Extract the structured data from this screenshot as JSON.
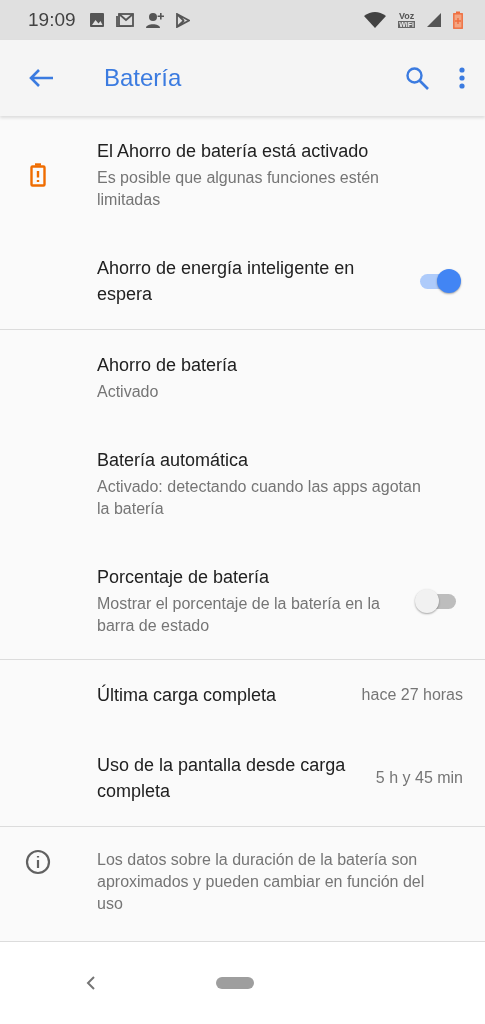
{
  "status_bar": {
    "time": "19:09",
    "volte_label": [
      "Voz",
      "WiFi"
    ]
  },
  "app_bar": {
    "title": "Batería"
  },
  "sections": [
    {
      "items": [
        {
          "kind": "alert",
          "title": "El Ahorro de batería está activado",
          "subtitle": "Es posible que algunas funciones estén limitadas"
        },
        {
          "kind": "toggle",
          "title": "Ahorro de energía inteligente en espera",
          "on": true
        }
      ]
    },
    {
      "items": [
        {
          "kind": "text",
          "title": "Ahorro de batería",
          "subtitle": "Activado"
        },
        {
          "kind": "text",
          "title": "Batería automática",
          "subtitle": "Activado: detectando cuando las apps agotan la batería"
        },
        {
          "kind": "toggle",
          "title": "Porcentaje de batería",
          "subtitle": "Mostrar el porcentaje de la batería en la barra de estado",
          "on": false
        }
      ]
    },
    {
      "items": [
        {
          "kind": "value",
          "title": "Última carga completa",
          "value": "hace 27 horas"
        },
        {
          "kind": "value",
          "title": "Uso de la pantalla desde carga completa",
          "value": "5 h y 45 min"
        }
      ]
    }
  ],
  "footer": {
    "text": "Los datos sobre la duración de la batería son aproximados y pueden cambiar en función del uso"
  }
}
